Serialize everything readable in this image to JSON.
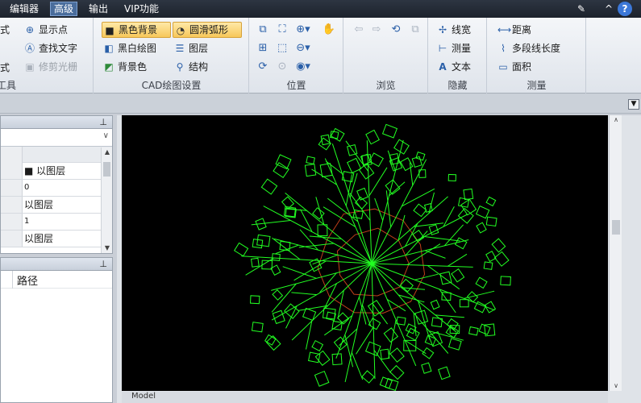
{
  "menu": {
    "items": [
      {
        "label": "编辑器",
        "active": false
      },
      {
        "label": "高级",
        "active": true
      },
      {
        "label": "输出",
        "active": false
      },
      {
        "label": "VIP功能",
        "active": false
      }
    ]
  },
  "top_icons": {
    "edit": "pencil-icon",
    "collapse": "^",
    "help": "?"
  },
  "ribbon": {
    "tools_group": {
      "label": "工具",
      "items": [
        "式",
        "式"
      ],
      "buttons": [
        {
          "label": "显示点",
          "icon": "plus-circle-icon",
          "disabled": false
        },
        {
          "label": "查找文字",
          "icon": "find-text-icon",
          "disabled": false
        },
        {
          "label": "修剪光栅",
          "icon": "trim-raster-icon",
          "disabled": true
        }
      ]
    },
    "cad_group": {
      "label": "CAD绘图设置",
      "buttons": [
        {
          "label": "黑色背景",
          "selected": true
        },
        {
          "label": "圆滑弧形",
          "selected": true
        },
        {
          "label": "黑白绘图",
          "selected": false
        },
        {
          "label": "图层",
          "selected": false
        },
        {
          "label": "背景色",
          "selected": false
        },
        {
          "label": "结构",
          "selected": false
        }
      ]
    },
    "position_group": {
      "label": "位置"
    },
    "browse_group": {
      "label": "浏览"
    },
    "hide_group": {
      "label": "隐藏",
      "buttons": [
        {
          "label": "线宽"
        },
        {
          "label": "测量"
        },
        {
          "label": "文本"
        }
      ]
    },
    "measure_group": {
      "label": "测量",
      "buttons": [
        {
          "label": "距离"
        },
        {
          "label": "多段线长度"
        },
        {
          "label": "面积"
        }
      ]
    }
  },
  "properties": {
    "rows": [
      {
        "value": "■ 以图层"
      },
      {
        "value": "0"
      },
      {
        "value": "以图层"
      },
      {
        "value": "1"
      },
      {
        "value": "以图层"
      }
    ]
  },
  "files": {
    "column": "路径"
  },
  "drawing": {
    "tab_label": "Model",
    "background": "#000000",
    "branch_color": "#22ff22",
    "center_color": "#c0401a",
    "branch_count": 23,
    "leaf_count": 120
  }
}
